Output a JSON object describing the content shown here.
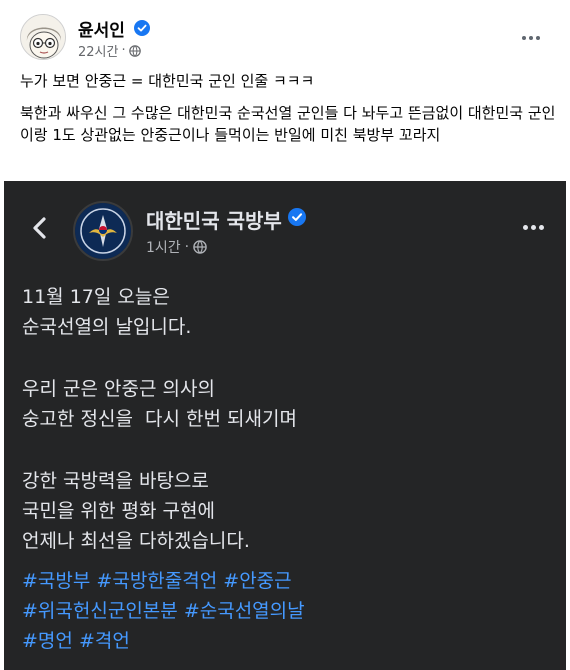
{
  "outer_post": {
    "author": "윤서인",
    "time": "22시간",
    "caption_line1": "누가 보면 안중근 = 대한민국 군인 인줄 ㅋㅋㅋ",
    "caption_line2": "북한과 싸우신 그 수많은 대한민국 순국선열 군인들 다 놔두고 뜬금없이 대한민국 군인이랑 1도 상관없는 안중근이나 들먹이는 반일에 미친 북방부 꼬라지"
  },
  "inner_post": {
    "author": "대한민국 국방부",
    "time": "1시간",
    "paragraphs": [
      [
        "11월 17일 오늘은",
        "순국선열의 날입니다."
      ],
      [
        "우리 군은 안중근 의사의",
        "숭고한 정신을  다시 한번 되새기며"
      ],
      [
        "강한 국방력을 바탕으로",
        "국민을 위한 평화 구현에",
        "언제나 최선을 다하겠습니다."
      ]
    ],
    "hashtags": [
      [
        "#국방부",
        "#국방한줄격언",
        "#안중근"
      ],
      [
        "#위국헌신군인본분",
        "#순국선열의날"
      ],
      [
        "#명언",
        "#격언"
      ]
    ]
  },
  "colors": {
    "verified": "#1877f2",
    "dark_bg": "#242526",
    "hashtag": "#4599ff"
  },
  "icons": {
    "verified": "verified-badge-icon",
    "audience": "globe-icon",
    "more": "more-options-icon",
    "back": "chevron-left-icon"
  }
}
